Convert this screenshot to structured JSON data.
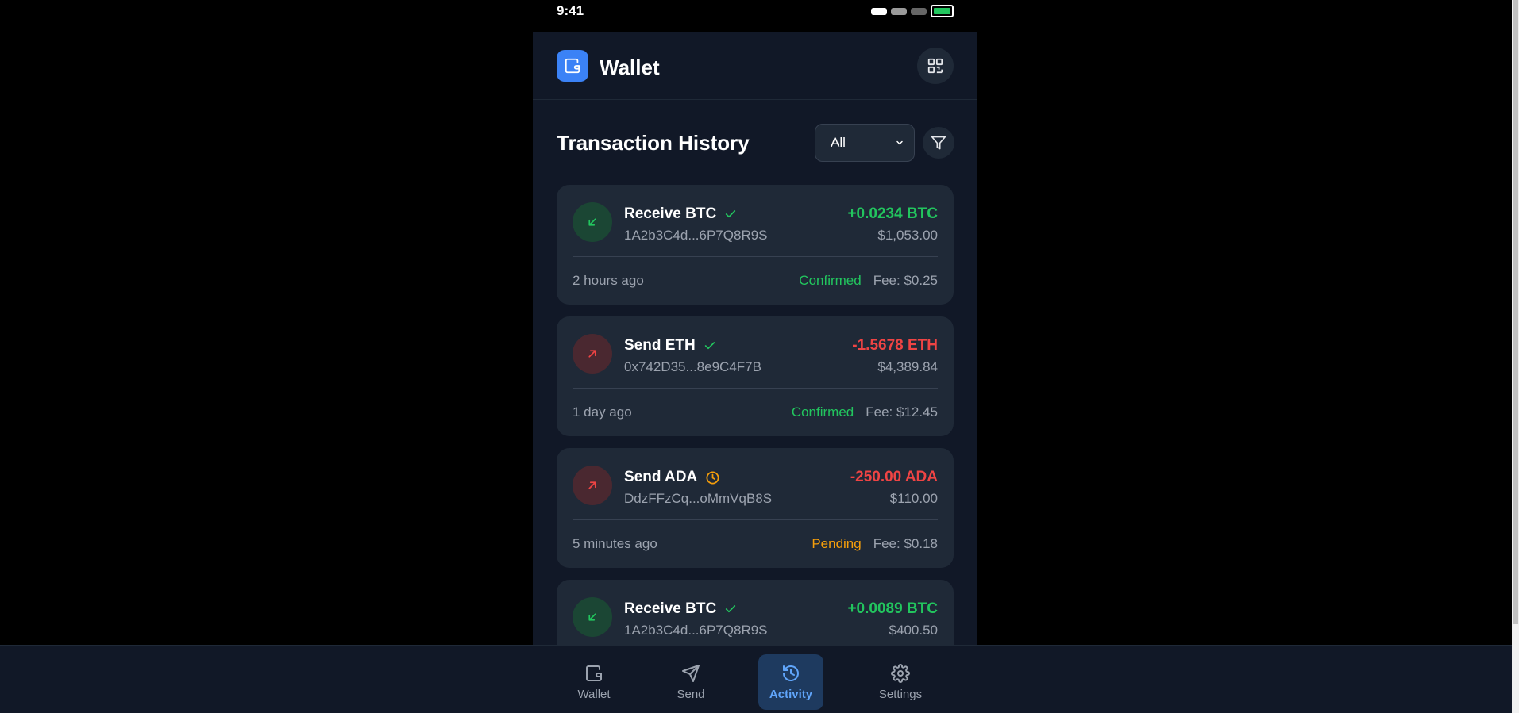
{
  "statusbar": {
    "time": "9:41"
  },
  "header": {
    "title": "Wallet",
    "logo_icon": "wallet-icon",
    "qr_icon": "qr-code-icon"
  },
  "section": {
    "title": "Transaction History",
    "filter": {
      "selected": "All",
      "options": [
        "All"
      ]
    },
    "filter_icon": "filter-icon"
  },
  "transactions": [
    {
      "type": "Receive BTC",
      "direction": "in",
      "status_icon": "check-icon",
      "address": "1A2b3C4d...6P7Q8R9S",
      "amount": "+0.0234 BTC",
      "usd": "$1,053.00",
      "time": "2 hours ago",
      "status": "Confirmed",
      "fee": "Fee: $0.25"
    },
    {
      "type": "Send ETH",
      "direction": "out",
      "status_icon": "check-icon",
      "address": "0x742D35...8e9C4F7B",
      "amount": "-1.5678 ETH",
      "usd": "$4,389.84",
      "time": "1 day ago",
      "status": "Confirmed",
      "fee": "Fee: $12.45"
    },
    {
      "type": "Send ADA",
      "direction": "out",
      "status_icon": "clock-icon",
      "address": "DdzFFzCq...oMmVqB8S",
      "amount": "-250.00 ADA",
      "usd": "$110.00",
      "time": "5 minutes ago",
      "status": "Pending",
      "fee": "Fee: $0.18"
    },
    {
      "type": "Receive BTC",
      "direction": "in",
      "status_icon": "check-icon",
      "address": "1A2b3C4d...6P7Q8R9S",
      "amount": "+0.0089 BTC",
      "usd": "$400.50",
      "time": "",
      "status": "",
      "fee": ""
    }
  ],
  "nav": [
    {
      "label": "Wallet",
      "icon": "wallet-icon",
      "active": false
    },
    {
      "label": "Send",
      "icon": "send-icon",
      "active": false
    },
    {
      "label": "Activity",
      "icon": "history-icon",
      "active": true
    },
    {
      "label": "Settings",
      "icon": "gear-icon",
      "active": false
    }
  ],
  "colors": {
    "accent": "#3b82f6",
    "positive": "#22c55e",
    "negative": "#ef4444",
    "pending": "#f59e0b",
    "background": "#111827",
    "card": "#1f2937"
  }
}
